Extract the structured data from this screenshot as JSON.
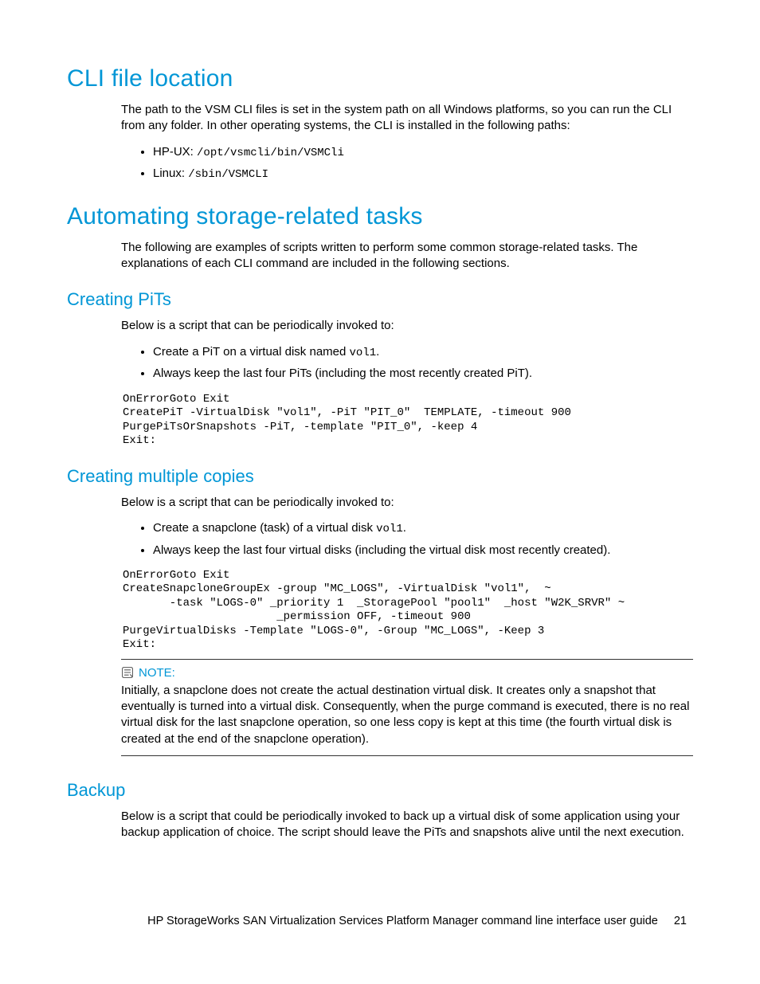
{
  "section1": {
    "heading": "CLI file location",
    "intro": "The path to the VSM CLI files is set in the system path on all Windows platforms, so you can run the CLI from any folder. In other operating systems, the CLI is installed in the following paths:",
    "bullets": [
      {
        "label": "HP-UX: ",
        "code": "/opt/vsmcli/bin/VSMCli"
      },
      {
        "label": "Linux: ",
        "code": "/sbin/VSMCLI"
      }
    ]
  },
  "section2": {
    "heading": "Automating storage-related tasks",
    "intro": "The following are examples of scripts written to perform some common storage-related tasks. The explanations of each CLI command are included in the following sections."
  },
  "pits": {
    "heading": "Creating PiTs",
    "intro": "Below is a script that can be periodically invoked to:",
    "b1_pre": "Create a PiT on a virtual disk named ",
    "b1_code": "vol1",
    "b1_post": ".",
    "b2": "Always keep the last four PiTs (including the most recently created PiT).",
    "code": "OnErrorGoto Exit\nCreatePiT -VirtualDisk \"vol1\", -PiT \"PIT_0\"  TEMPLATE, -timeout 900\nPurgePiTsOrSnapshots -PiT, -template \"PIT_0\", -keep 4\nExit:"
  },
  "copies": {
    "heading": "Creating multiple copies",
    "intro": "Below is a script that can be periodically invoked to:",
    "b1_pre": "Create a snapclone (task) of a virtual disk ",
    "b1_code": "vol1",
    "b1_post": ".",
    "b2": "Always keep the last four virtual disks (including the virtual disk most recently created).",
    "code": "OnErrorGoto Exit\nCreateSnapcloneGroupEx -group \"MC_LOGS\", -VirtualDisk \"vol1\",  ~\n       -task \"LOGS-0\" _priority 1  _StoragePool \"pool1\"  _host \"W2K_SRVR\" ~\n                       _permission OFF, -timeout 900\nPurgeVirtualDisks -Template \"LOGS-0\", -Group \"MC_LOGS\", -Keep 3\nExit:"
  },
  "note": {
    "label": "NOTE:",
    "body": "Initially, a snapclone does not create the actual destination virtual disk. It creates only a snapshot that eventually is turned into a virtual disk. Consequently, when the purge command is executed, there is no real virtual disk for the last snapclone operation, so one less copy is kept at this time (the fourth virtual disk is created at the end of the snapclone operation)."
  },
  "backup": {
    "heading": "Backup",
    "intro": "Below is a script that could be periodically invoked to back up a virtual disk of some application using your backup application of choice. The script should leave the PiTs and snapshots alive until the next execution."
  },
  "footer": {
    "text": "HP StorageWorks SAN Virtualization Services Platform Manager command line interface user guide",
    "page": "21"
  }
}
